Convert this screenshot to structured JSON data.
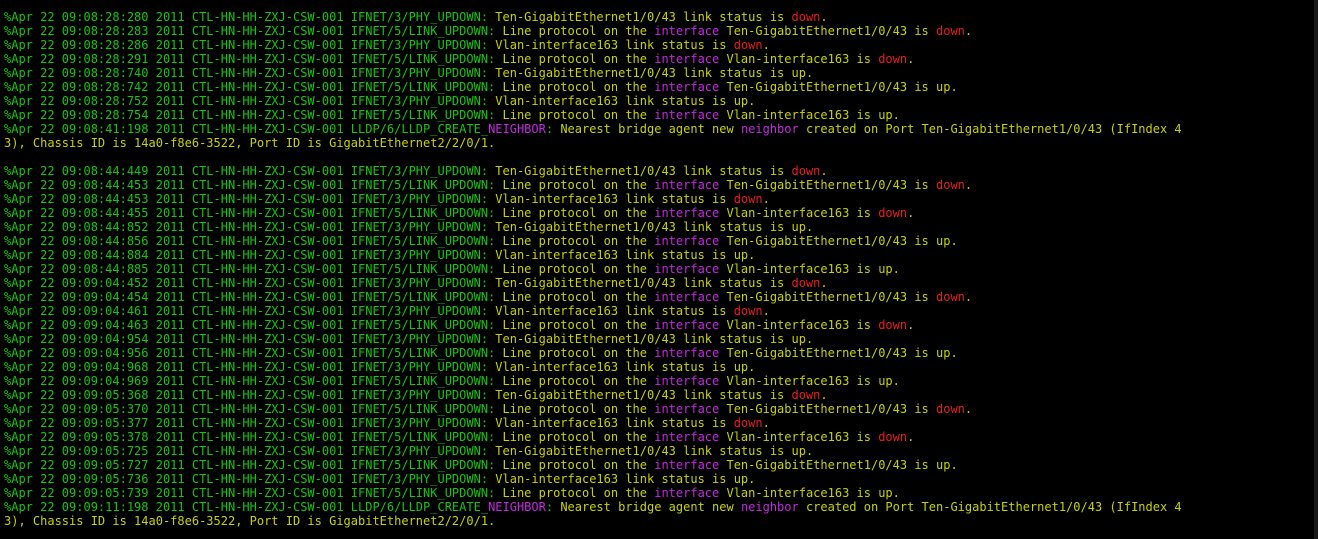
{
  "colors": {
    "background": "#000000",
    "prefix": "#16c60c",
    "message": "#c8d300",
    "keyword_down": "#e81e1e",
    "keyword_interface": "#c428e0"
  },
  "log_lines": [
    [
      [
        "g",
        "%Apr 22 09:08:28:280 2011 CTL-HN-HH-ZXJ-CSW-001 IFNET/3/PHY_UPDOWN: "
      ],
      [
        "y",
        "Ten-GigabitEthernet1/0/43 link status is "
      ],
      [
        "r",
        "down"
      ],
      [
        "y",
        "."
      ]
    ],
    [
      [
        "g",
        "%Apr 22 09:08:28:283 2011 CTL-HN-HH-ZXJ-CSW-001 IFNET/5/LINK_UPDOWN: "
      ],
      [
        "y",
        "Line protocol on the "
      ],
      [
        "m",
        "interface"
      ],
      [
        "y",
        " Ten-GigabitEthernet1/0/43 is "
      ],
      [
        "r",
        "down"
      ],
      [
        "y",
        "."
      ]
    ],
    [
      [
        "g",
        "%Apr 22 09:08:28:286 2011 CTL-HN-HH-ZXJ-CSW-001 IFNET/3/PHY_UPDOWN: "
      ],
      [
        "y",
        "Vlan-interface163 link status is "
      ],
      [
        "r",
        "down"
      ],
      [
        "y",
        "."
      ]
    ],
    [
      [
        "g",
        "%Apr 22 09:08:28:291 2011 CTL-HN-HH-ZXJ-CSW-001 IFNET/5/LINK_UPDOWN: "
      ],
      [
        "y",
        "Line protocol on the "
      ],
      [
        "m",
        "interface"
      ],
      [
        "y",
        " Vlan-interface163 is "
      ],
      [
        "r",
        "down"
      ],
      [
        "y",
        "."
      ]
    ],
    [
      [
        "g",
        "%Apr 22 09:08:28:740 2011 CTL-HN-HH-ZXJ-CSW-001 IFNET/3/PHY_UPDOWN: "
      ],
      [
        "y",
        "Ten-GigabitEthernet1/0/43 link status is up."
      ]
    ],
    [
      [
        "g",
        "%Apr 22 09:08:28:742 2011 CTL-HN-HH-ZXJ-CSW-001 IFNET/5/LINK_UPDOWN: "
      ],
      [
        "y",
        "Line protocol on the "
      ],
      [
        "m",
        "interface"
      ],
      [
        "y",
        " Ten-GigabitEthernet1/0/43 is up."
      ]
    ],
    [
      [
        "g",
        "%Apr 22 09:08:28:752 2011 CTL-HN-HH-ZXJ-CSW-001 IFNET/3/PHY_UPDOWN: "
      ],
      [
        "y",
        "Vlan-interface163 link status is up."
      ]
    ],
    [
      [
        "g",
        "%Apr 22 09:08:28:754 2011 CTL-HN-HH-ZXJ-CSW-001 IFNET/5/LINK_UPDOWN: "
      ],
      [
        "y",
        "Line protocol on the "
      ],
      [
        "m",
        "interface"
      ],
      [
        "y",
        " Vlan-interface163 is up."
      ]
    ],
    [
      [
        "g",
        "%Apr 22 09:08:41:198 2011 CTL-HN-HH-ZXJ-CSW-001 LLDP/6/LLDP_CREATE_"
      ],
      [
        "m",
        "NEIGHBOR"
      ],
      [
        "g",
        ": "
      ],
      [
        "y",
        "Nearest bridge agent new "
      ],
      [
        "m",
        "neighbor"
      ],
      [
        "y",
        " created on Port Ten-GigabitEthernet1/0/43 (IfIndex 4"
      ]
    ],
    [
      [
        "y",
        "3), Chassis ID is 14a0-f8e6-3522, Port ID is GigabitEthernet2/2/0/1."
      ]
    ],
    [
      [
        "g",
        ""
      ]
    ],
    [
      [
        "g",
        "%Apr 22 09:08:44:449 2011 CTL-HN-HH-ZXJ-CSW-001 IFNET/3/PHY_UPDOWN: "
      ],
      [
        "y",
        "Ten-GigabitEthernet1/0/43 link status is "
      ],
      [
        "r",
        "down"
      ],
      [
        "y",
        "."
      ]
    ],
    [
      [
        "g",
        "%Apr 22 09:08:44:453 2011 CTL-HN-HH-ZXJ-CSW-001 IFNET/5/LINK_UPDOWN: "
      ],
      [
        "y",
        "Line protocol on the "
      ],
      [
        "m",
        "interface"
      ],
      [
        "y",
        " Ten-GigabitEthernet1/0/43 is "
      ],
      [
        "r",
        "down"
      ],
      [
        "y",
        "."
      ]
    ],
    [
      [
        "g",
        "%Apr 22 09:08:44:453 2011 CTL-HN-HH-ZXJ-CSW-001 IFNET/3/PHY_UPDOWN: "
      ],
      [
        "y",
        "Vlan-interface163 link status is "
      ],
      [
        "r",
        "down"
      ],
      [
        "y",
        "."
      ]
    ],
    [
      [
        "g",
        "%Apr 22 09:08:44:455 2011 CTL-HN-HH-ZXJ-CSW-001 IFNET/5/LINK_UPDOWN: "
      ],
      [
        "y",
        "Line protocol on the "
      ],
      [
        "m",
        "interface"
      ],
      [
        "y",
        " Vlan-interface163 is "
      ],
      [
        "r",
        "down"
      ],
      [
        "y",
        "."
      ]
    ],
    [
      [
        "g",
        "%Apr 22 09:08:44:852 2011 CTL-HN-HH-ZXJ-CSW-001 IFNET/3/PHY_UPDOWN: "
      ],
      [
        "y",
        "Ten-GigabitEthernet1/0/43 link status is up."
      ]
    ],
    [
      [
        "g",
        "%Apr 22 09:08:44:856 2011 CTL-HN-HH-ZXJ-CSW-001 IFNET/5/LINK_UPDOWN: "
      ],
      [
        "y",
        "Line protocol on the "
      ],
      [
        "m",
        "interface"
      ],
      [
        "y",
        " Ten-GigabitEthernet1/0/43 is up."
      ]
    ],
    [
      [
        "g",
        "%Apr 22 09:08:44:884 2011 CTL-HN-HH-ZXJ-CSW-001 IFNET/3/PHY_UPDOWN: "
      ],
      [
        "y",
        "Vlan-interface163 link status is up."
      ]
    ],
    [
      [
        "g",
        "%Apr 22 09:08:44:885 2011 CTL-HN-HH-ZXJ-CSW-001 IFNET/5/LINK_UPDOWN: "
      ],
      [
        "y",
        "Line protocol on the "
      ],
      [
        "m",
        "interface"
      ],
      [
        "y",
        " Vlan-interface163 is up."
      ]
    ],
    [
      [
        "g",
        "%Apr 22 09:09:04:452 2011 CTL-HN-HH-ZXJ-CSW-001 IFNET/3/PHY_UPDOWN: "
      ],
      [
        "y",
        "Ten-GigabitEthernet1/0/43 link status is "
      ],
      [
        "r",
        "down"
      ],
      [
        "y",
        "."
      ]
    ],
    [
      [
        "g",
        "%Apr 22 09:09:04:454 2011 CTL-HN-HH-ZXJ-CSW-001 IFNET/5/LINK_UPDOWN: "
      ],
      [
        "y",
        "Line protocol on the "
      ],
      [
        "m",
        "interface"
      ],
      [
        "y",
        " Ten-GigabitEthernet1/0/43 is "
      ],
      [
        "r",
        "down"
      ],
      [
        "y",
        "."
      ]
    ],
    [
      [
        "g",
        "%Apr 22 09:09:04:461 2011 CTL-HN-HH-ZXJ-CSW-001 IFNET/3/PHY_UPDOWN: "
      ],
      [
        "y",
        "Vlan-interface163 link status is "
      ],
      [
        "r",
        "down"
      ],
      [
        "y",
        "."
      ]
    ],
    [
      [
        "g",
        "%Apr 22 09:09:04:463 2011 CTL-HN-HH-ZXJ-CSW-001 IFNET/5/LINK_UPDOWN: "
      ],
      [
        "y",
        "Line protocol on the "
      ],
      [
        "m",
        "interface"
      ],
      [
        "y",
        " Vlan-interface163 is "
      ],
      [
        "r",
        "down"
      ],
      [
        "y",
        "."
      ]
    ],
    [
      [
        "g",
        "%Apr 22 09:09:04:954 2011 CTL-HN-HH-ZXJ-CSW-001 IFNET/3/PHY_UPDOWN: "
      ],
      [
        "y",
        "Ten-GigabitEthernet1/0/43 link status is up."
      ]
    ],
    [
      [
        "g",
        "%Apr 22 09:09:04:956 2011 CTL-HN-HH-ZXJ-CSW-001 IFNET/5/LINK_UPDOWN: "
      ],
      [
        "y",
        "Line protocol on the "
      ],
      [
        "m",
        "interface"
      ],
      [
        "y",
        " Ten-GigabitEthernet1/0/43 is up."
      ]
    ],
    [
      [
        "g",
        "%Apr 22 09:09:04:968 2011 CTL-HN-HH-ZXJ-CSW-001 IFNET/3/PHY_UPDOWN: "
      ],
      [
        "y",
        "Vlan-interface163 link status is up."
      ]
    ],
    [
      [
        "g",
        "%Apr 22 09:09:04:969 2011 CTL-HN-HH-ZXJ-CSW-001 IFNET/5/LINK_UPDOWN: "
      ],
      [
        "y",
        "Line protocol on the "
      ],
      [
        "m",
        "interface"
      ],
      [
        "y",
        " Vlan-interface163 is up."
      ]
    ],
    [
      [
        "g",
        "%Apr 22 09:09:05:368 2011 CTL-HN-HH-ZXJ-CSW-001 IFNET/3/PHY_UPDOWN: "
      ],
      [
        "y",
        "Ten-GigabitEthernet1/0/43 link status is "
      ],
      [
        "r",
        "down"
      ],
      [
        "y",
        "."
      ]
    ],
    [
      [
        "g",
        "%Apr 22 09:09:05:370 2011 CTL-HN-HH-ZXJ-CSW-001 IFNET/5/LINK_UPDOWN: "
      ],
      [
        "y",
        "Line protocol on the "
      ],
      [
        "m",
        "interface"
      ],
      [
        "y",
        " Ten-GigabitEthernet1/0/43 is "
      ],
      [
        "r",
        "down"
      ],
      [
        "y",
        "."
      ]
    ],
    [
      [
        "g",
        "%Apr 22 09:09:05:377 2011 CTL-HN-HH-ZXJ-CSW-001 IFNET/3/PHY_UPDOWN: "
      ],
      [
        "y",
        "Vlan-interface163 link status is "
      ],
      [
        "r",
        "down"
      ],
      [
        "y",
        "."
      ]
    ],
    [
      [
        "g",
        "%Apr 22 09:09:05:378 2011 CTL-HN-HH-ZXJ-CSW-001 IFNET/5/LINK_UPDOWN: "
      ],
      [
        "y",
        "Line protocol on the "
      ],
      [
        "m",
        "interface"
      ],
      [
        "y",
        " Vlan-interface163 is "
      ],
      [
        "r",
        "down"
      ],
      [
        "y",
        "."
      ]
    ],
    [
      [
        "g",
        "%Apr 22 09:09:05:725 2011 CTL-HN-HH-ZXJ-CSW-001 IFNET/3/PHY_UPDOWN: "
      ],
      [
        "y",
        "Ten-GigabitEthernet1/0/43 link status is up."
      ]
    ],
    [
      [
        "g",
        "%Apr 22 09:09:05:727 2011 CTL-HN-HH-ZXJ-CSW-001 IFNET/5/LINK_UPDOWN: "
      ],
      [
        "y",
        "Line protocol on the "
      ],
      [
        "m",
        "interface"
      ],
      [
        "y",
        " Ten-GigabitEthernet1/0/43 is up."
      ]
    ],
    [
      [
        "g",
        "%Apr 22 09:09:05:736 2011 CTL-HN-HH-ZXJ-CSW-001 IFNET/3/PHY_UPDOWN: "
      ],
      [
        "y",
        "Vlan-interface163 link status is up."
      ]
    ],
    [
      [
        "g",
        "%Apr 22 09:09:05:739 2011 CTL-HN-HH-ZXJ-CSW-001 IFNET/5/LINK_UPDOWN: "
      ],
      [
        "y",
        "Line protocol on the "
      ],
      [
        "m",
        "interface"
      ],
      [
        "y",
        " Vlan-interface163 is up."
      ]
    ],
    [
      [
        "g",
        "%Apr 22 09:09:11:198 2011 CTL-HN-HH-ZXJ-CSW-001 LLDP/6/LLDP_CREATE_"
      ],
      [
        "m",
        "NEIGHBOR"
      ],
      [
        "g",
        ": "
      ],
      [
        "y",
        "Nearest bridge agent new "
      ],
      [
        "m",
        "neighbor"
      ],
      [
        "y",
        " created on Port Ten-GigabitEthernet1/0/43 (IfIndex 4"
      ]
    ],
    [
      [
        "y",
        "3), Chassis ID is 14a0-f8e6-3522, Port ID is GigabitEthernet2/2/0/1."
      ]
    ]
  ]
}
